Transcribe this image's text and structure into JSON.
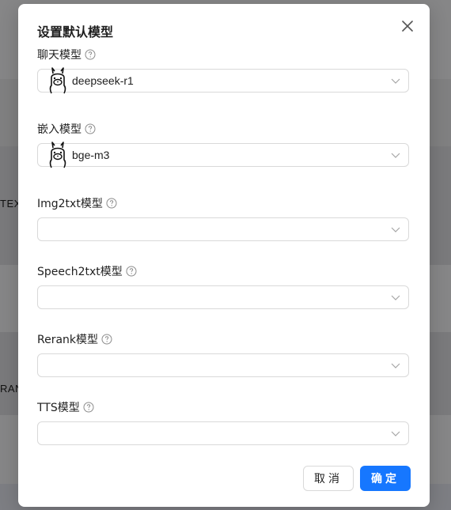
{
  "background": {
    "snippet_1": "TEXT",
    "snippet_2": "RAN"
  },
  "modal": {
    "title": "设置默认模型",
    "close_icon": "close-icon",
    "fields": [
      {
        "label": "聊天模型",
        "value": "deepseek-r1",
        "icon": "llama-icon"
      },
      {
        "label": "嵌入模型",
        "value": "bge-m3",
        "icon": "llama-icon"
      },
      {
        "label": "Img2txt模型",
        "value": ""
      },
      {
        "label": "Speech2txt模型",
        "value": ""
      },
      {
        "label": "Rerank模型",
        "value": ""
      },
      {
        "label": "TTS模型",
        "value": ""
      }
    ],
    "buttons": {
      "cancel": "取消",
      "ok": "确定"
    }
  },
  "colors": {
    "primary": "#1677ff",
    "border": "#d9d9d9",
    "text": "#1f1f1f"
  }
}
